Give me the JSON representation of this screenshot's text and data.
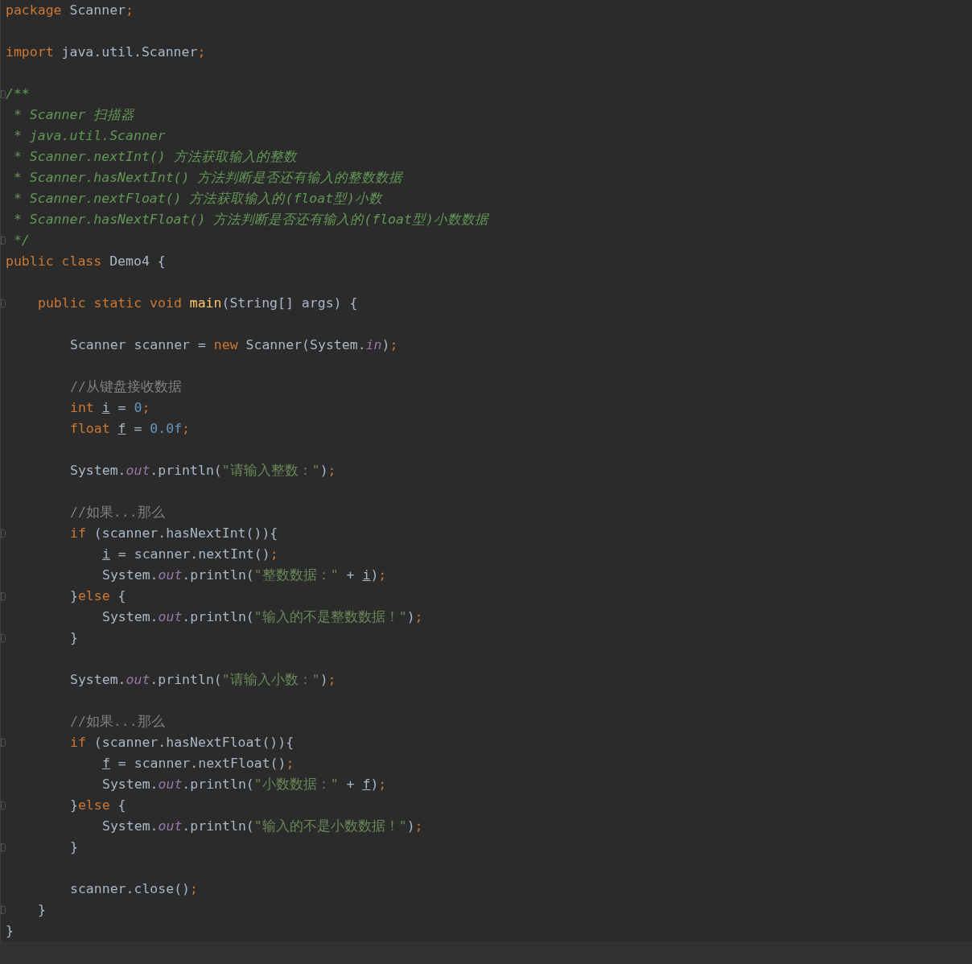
{
  "lines": [
    {
      "kind": "code",
      "fold": false,
      "tokens": [
        {
          "kind": "keyword",
          "text": "package "
        },
        {
          "kind": "plain",
          "text": "Scanner"
        },
        {
          "kind": "semi",
          "text": ";"
        }
      ]
    },
    {
      "kind": "blank",
      "fold": false
    },
    {
      "kind": "code",
      "fold": false,
      "tokens": [
        {
          "kind": "keyword",
          "text": "import "
        },
        {
          "kind": "plain",
          "text": "java.util.Scanner"
        },
        {
          "kind": "semi",
          "text": ";"
        }
      ]
    },
    {
      "kind": "blank",
      "fold": false
    },
    {
      "kind": "code",
      "fold": true,
      "tokens": [
        {
          "kind": "doc",
          "text": "/**"
        }
      ]
    },
    {
      "kind": "code",
      "fold": false,
      "tokens": [
        {
          "kind": "doc",
          "text": " * Scanner 扫描器"
        }
      ]
    },
    {
      "kind": "code",
      "fold": false,
      "tokens": [
        {
          "kind": "doc",
          "text": " * java.util.Scanner"
        }
      ]
    },
    {
      "kind": "code",
      "fold": false,
      "tokens": [
        {
          "kind": "doc",
          "text": " * Scanner.nextInt() 方法获取输入的整数"
        }
      ]
    },
    {
      "kind": "code",
      "fold": false,
      "tokens": [
        {
          "kind": "doc",
          "text": " * Scanner.hasNextInt() 方法判断是否还有输入的整数数据"
        }
      ]
    },
    {
      "kind": "code",
      "fold": false,
      "tokens": [
        {
          "kind": "doc",
          "text": " * Scanner.nextFloat() 方法获取输入的(float型)小数"
        }
      ]
    },
    {
      "kind": "code",
      "fold": false,
      "tokens": [
        {
          "kind": "doc",
          "text": " * Scanner.hasNextFloat() 方法判断是否还有输入的(float型)小数数据"
        }
      ]
    },
    {
      "kind": "code",
      "fold": true,
      "tokens": [
        {
          "kind": "doc",
          "text": " */"
        }
      ]
    },
    {
      "kind": "code",
      "fold": false,
      "tokens": [
        {
          "kind": "keyword",
          "text": "public class "
        },
        {
          "kind": "plain",
          "text": "Demo4 {"
        }
      ],
      "children": [
        {
          "kind": "blank",
          "fold": false
        },
        {
          "kind": "code",
          "fold": true,
          "tokens": [
            {
              "kind": "keyword",
              "text": "public static void "
            },
            {
              "kind": "method",
              "text": "main"
            },
            {
              "kind": "plain",
              "text": "(String[] args) {"
            }
          ],
          "children": [
            {
              "kind": "blank",
              "fold": false
            },
            {
              "kind": "code",
              "fold": false,
              "tokens": [
                {
                  "kind": "plain",
                  "text": "Scanner scanner = "
                },
                {
                  "kind": "keyword",
                  "text": "new "
                },
                {
                  "kind": "plain",
                  "text": "Scanner(System."
                },
                {
                  "kind": "field",
                  "text": "in"
                },
                {
                  "kind": "plain",
                  "text": ")"
                },
                {
                  "kind": "semi",
                  "text": ";"
                }
              ]
            },
            {
              "kind": "blank",
              "fold": false
            },
            {
              "kind": "code",
              "fold": false,
              "tokens": [
                {
                  "kind": "comment",
                  "text": "//从键盘接收数据"
                }
              ]
            },
            {
              "kind": "code",
              "fold": false,
              "tokens": [
                {
                  "kind": "keyword",
                  "text": "int "
                },
                {
                  "kind": "var",
                  "text": "i"
                },
                {
                  "kind": "plain",
                  "text": " = "
                },
                {
                  "kind": "number",
                  "text": "0"
                },
                {
                  "kind": "semi",
                  "text": ";"
                }
              ]
            },
            {
              "kind": "code",
              "fold": false,
              "tokens": [
                {
                  "kind": "keyword",
                  "text": "float "
                },
                {
                  "kind": "var",
                  "text": "f"
                },
                {
                  "kind": "plain",
                  "text": " = "
                },
                {
                  "kind": "number",
                  "text": "0.0f"
                },
                {
                  "kind": "semi",
                  "text": ";"
                }
              ]
            },
            {
              "kind": "blank",
              "fold": false
            },
            {
              "kind": "code",
              "fold": false,
              "tokens": [
                {
                  "kind": "plain",
                  "text": "System."
                },
                {
                  "kind": "field",
                  "text": "out"
                },
                {
                  "kind": "plain",
                  "text": ".println("
                },
                {
                  "kind": "string",
                  "text": "\"请输入整数：\""
                },
                {
                  "kind": "plain",
                  "text": ")"
                },
                {
                  "kind": "semi",
                  "text": ";"
                }
              ]
            },
            {
              "kind": "blank",
              "fold": false
            },
            {
              "kind": "code",
              "fold": false,
              "tokens": [
                {
                  "kind": "comment",
                  "text": "//如果...那么"
                }
              ]
            },
            {
              "kind": "code",
              "fold": true,
              "tokens": [
                {
                  "kind": "keyword",
                  "text": "if "
                },
                {
                  "kind": "plain",
                  "text": "(scanner.hasNextInt()){"
                }
              ],
              "children": [
                {
                  "kind": "code",
                  "fold": false,
                  "tokens": [
                    {
                      "kind": "var",
                      "text": "i"
                    },
                    {
                      "kind": "plain",
                      "text": " = scanner.nextInt()"
                    },
                    {
                      "kind": "semi",
                      "text": ";"
                    }
                  ]
                },
                {
                  "kind": "code",
                  "fold": false,
                  "tokens": [
                    {
                      "kind": "plain",
                      "text": "System."
                    },
                    {
                      "kind": "field",
                      "text": "out"
                    },
                    {
                      "kind": "plain",
                      "text": ".println("
                    },
                    {
                      "kind": "string",
                      "text": "\"整数数据：\""
                    },
                    {
                      "kind": "plain",
                      "text": " + "
                    },
                    {
                      "kind": "var",
                      "text": "i"
                    },
                    {
                      "kind": "plain",
                      "text": ")"
                    },
                    {
                      "kind": "semi",
                      "text": ";"
                    }
                  ]
                }
              ]
            },
            {
              "kind": "code",
              "fold": true,
              "tokens": [
                {
                  "kind": "plain",
                  "text": "}"
                },
                {
                  "kind": "keyword",
                  "text": "else "
                },
                {
                  "kind": "plain",
                  "text": "{"
                }
              ],
              "children": [
                {
                  "kind": "code",
                  "fold": false,
                  "tokens": [
                    {
                      "kind": "plain",
                      "text": "System."
                    },
                    {
                      "kind": "field",
                      "text": "out"
                    },
                    {
                      "kind": "plain",
                      "text": ".println("
                    },
                    {
                      "kind": "string",
                      "text": "\"输入的不是整数数据！\""
                    },
                    {
                      "kind": "plain",
                      "text": ")"
                    },
                    {
                      "kind": "semi",
                      "text": ";"
                    }
                  ]
                }
              ]
            },
            {
              "kind": "code",
              "fold": true,
              "tokens": [
                {
                  "kind": "plain",
                  "text": "}"
                }
              ]
            },
            {
              "kind": "blank",
              "fold": false
            },
            {
              "kind": "code",
              "fold": false,
              "tokens": [
                {
                  "kind": "plain",
                  "text": "System."
                },
                {
                  "kind": "field",
                  "text": "out"
                },
                {
                  "kind": "plain",
                  "text": ".println("
                },
                {
                  "kind": "string",
                  "text": "\"请输入小数：\""
                },
                {
                  "kind": "plain",
                  "text": ")"
                },
                {
                  "kind": "semi",
                  "text": ";"
                }
              ]
            },
            {
              "kind": "blank",
              "fold": false
            },
            {
              "kind": "code",
              "fold": false,
              "tokens": [
                {
                  "kind": "comment",
                  "text": "//如果...那么"
                }
              ]
            },
            {
              "kind": "code",
              "fold": true,
              "tokens": [
                {
                  "kind": "keyword",
                  "text": "if "
                },
                {
                  "kind": "plain",
                  "text": "(scanner.hasNextFloat()){"
                }
              ],
              "children": [
                {
                  "kind": "code",
                  "fold": false,
                  "tokens": [
                    {
                      "kind": "var",
                      "text": "f"
                    },
                    {
                      "kind": "plain",
                      "text": " = scanner.nextFloat()"
                    },
                    {
                      "kind": "semi",
                      "text": ";"
                    }
                  ]
                },
                {
                  "kind": "code",
                  "fold": false,
                  "tokens": [
                    {
                      "kind": "plain",
                      "text": "System."
                    },
                    {
                      "kind": "field",
                      "text": "out"
                    },
                    {
                      "kind": "plain",
                      "text": ".println("
                    },
                    {
                      "kind": "string",
                      "text": "\"小数数据：\""
                    },
                    {
                      "kind": "plain",
                      "text": " + "
                    },
                    {
                      "kind": "var",
                      "text": "f"
                    },
                    {
                      "kind": "plain",
                      "text": ")"
                    },
                    {
                      "kind": "semi",
                      "text": ";"
                    }
                  ]
                }
              ]
            },
            {
              "kind": "code",
              "fold": true,
              "tokens": [
                {
                  "kind": "plain",
                  "text": "}"
                },
                {
                  "kind": "keyword",
                  "text": "else "
                },
                {
                  "kind": "plain",
                  "text": "{"
                }
              ],
              "children": [
                {
                  "kind": "code",
                  "fold": false,
                  "tokens": [
                    {
                      "kind": "plain",
                      "text": "System."
                    },
                    {
                      "kind": "field",
                      "text": "out"
                    },
                    {
                      "kind": "plain",
                      "text": ".println("
                    },
                    {
                      "kind": "string",
                      "text": "\"输入的不是小数数据！\""
                    },
                    {
                      "kind": "plain",
                      "text": ")"
                    },
                    {
                      "kind": "semi",
                      "text": ";"
                    }
                  ]
                }
              ]
            },
            {
              "kind": "code",
              "fold": true,
              "tokens": [
                {
                  "kind": "plain",
                  "text": "}"
                }
              ]
            },
            {
              "kind": "blank",
              "fold": false
            },
            {
              "kind": "code",
              "fold": false,
              "tokens": [
                {
                  "kind": "plain",
                  "text": "scanner.close()"
                },
                {
                  "kind": "semi",
                  "text": ";"
                }
              ]
            }
          ]
        },
        {
          "kind": "code",
          "fold": true,
          "tokens": [
            {
              "kind": "plain",
              "text": "}"
            }
          ]
        }
      ]
    },
    {
      "kind": "code",
      "fold": false,
      "tokens": [
        {
          "kind": "plain",
          "text": "}"
        }
      ]
    }
  ]
}
